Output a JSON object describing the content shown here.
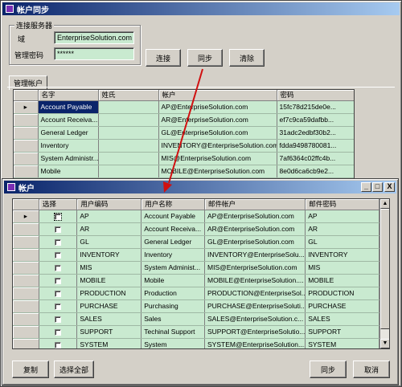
{
  "sync_window": {
    "title": "帐户同步",
    "server_group": {
      "label": "连接服务器",
      "domain_label": "域",
      "domain_value": "EnterpriseSolution.com",
      "password_label": "管理密码",
      "password_value": "******"
    },
    "connect_label": "连接",
    "sync_label": "同步",
    "clear_label": "清除",
    "tab_label": "管理帐户",
    "columns": [
      "名字",
      "姓氏",
      "帐户",
      "密码"
    ],
    "rows": [
      [
        "Account Payable",
        "",
        "AP@EnterpriseSolution.com",
        "15fc78d215de0e..."
      ],
      [
        "Account Receiva...",
        "",
        "AR@EnterpriseSolution.com",
        "ef7c9ca59dafbb..."
      ],
      [
        "General Ledger",
        "",
        "GL@EnterpriseSolution.com",
        "31adc2edbf30b2..."
      ],
      [
        "Inventory",
        "",
        "INVENTORY@EnterpriseSolution.com",
        "fdda9498780081..."
      ],
      [
        "System Administr...",
        "",
        "MIS@EnterpriseSolution.com",
        "7af6364c02ffc4b..."
      ],
      [
        "Mobile",
        "",
        "MOBILE@EnterpriseSolution.com",
        "8e0d6ca6cb9e2..."
      ]
    ]
  },
  "account_window": {
    "title": "帐户",
    "columns": [
      "选择",
      "用户编码",
      "用户名称",
      "邮件帐户",
      "邮件密码"
    ],
    "rows": [
      [
        "AP",
        "Account Payable",
        "AP@EnterpriseSolution.com",
        "AP"
      ],
      [
        "AR",
        "Account Receiva...",
        "AR@EnterpriseSolution.com",
        "AR"
      ],
      [
        "GL",
        "General Ledger",
        "GL@EnterpriseSolution.com",
        "GL"
      ],
      [
        "INVENTORY",
        "Inventory",
        "INVENTORY@EnterpriseSolu...",
        "INVENTORY"
      ],
      [
        "MIS",
        "System Administ...",
        "MIS@EnterpriseSolution.com",
        "MIS"
      ],
      [
        "MOBILE",
        "Mobile",
        "MOBILE@EnterpriseSolution....",
        "MOBILE"
      ],
      [
        "PRODUCTION",
        "Production",
        "PRODUCTION@EnterpriseSol...",
        "PRODUCTION"
      ],
      [
        "PURCHASE",
        "Purchasing",
        "PURCHASE@EnterpriseSoluti...",
        "PURCHASE"
      ],
      [
        "SALES",
        "Sales",
        "SALES@EnterpriseSolution.c...",
        "SALES"
      ],
      [
        "SUPPORT",
        "Techinal Support",
        "SUPPORT@EnterpriseSolutio...",
        "SUPPORT"
      ],
      [
        "SYSTEM",
        "System",
        "SYSTEM@EnterpriseSolution....",
        "SYSTEM"
      ]
    ],
    "copy_label": "复制",
    "select_all_label": "选择全部",
    "sync_label": "同步",
    "cancel_label": "取消",
    "min_glyph": "_",
    "max_glyph": "□",
    "close_glyph": "X"
  },
  "colors": {
    "title_gradient_start": "#0a246a",
    "title_gradient_end": "#a6caf0",
    "grid_green": "#c9ead0",
    "arrow": "#d01010"
  }
}
